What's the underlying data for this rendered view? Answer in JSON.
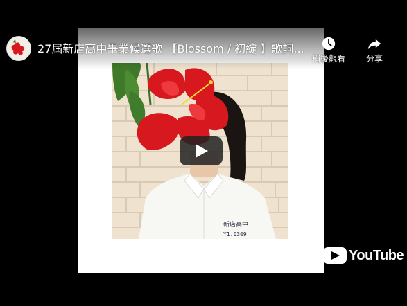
{
  "video": {
    "title": "27屆新店高中畢業候選歌 【Blossom / 初綻 】歌詞...",
    "channel_avatar_icon": "flower-avatar-icon"
  },
  "controls": {
    "watch_later_label": "稍後觀看",
    "share_label": "分享"
  },
  "branding": {
    "logo_text": "YouTube",
    "logo_color": "#ffffff"
  },
  "thumbnail": {
    "name_tag_line1": "新店高中",
    "name_tag_line2": "Y1.0309",
    "flower_color": "#d7191f",
    "wall_color": "#efe3cf"
  }
}
